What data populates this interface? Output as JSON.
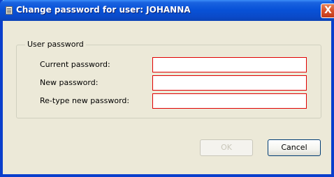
{
  "window": {
    "title": "Change password for user: JOHANNA",
    "close_glyph": "X"
  },
  "group": {
    "legend": "User password"
  },
  "fields": [
    {
      "label": "Current password:",
      "value": ""
    },
    {
      "label": "New password:",
      "value": ""
    },
    {
      "label": "Re-type new password:",
      "value": ""
    }
  ],
  "buttons": {
    "ok_label": "OK",
    "ok_enabled": false,
    "cancel_label": "Cancel"
  },
  "colors": {
    "titlebar": "#0852d8",
    "dialog_bg": "#ece9d8",
    "input_border_invalid": "#e00000",
    "close_button": "#d9512a"
  },
  "icons": {
    "app": "document-icon",
    "close": "close-icon"
  }
}
